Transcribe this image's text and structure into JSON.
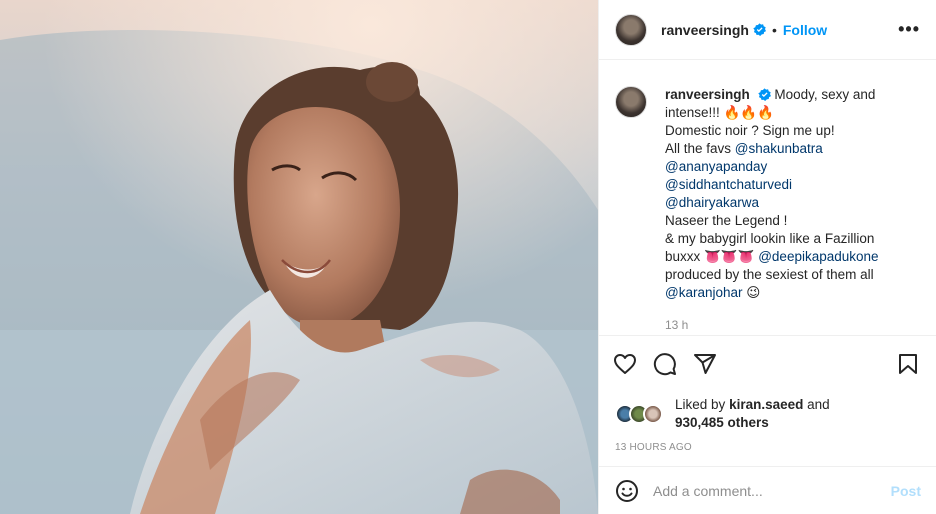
{
  "post": {
    "username": "ranveersingh",
    "follow_label": "Follow",
    "more_label": "•••",
    "separator": "•"
  },
  "caption": {
    "username": "ranveersingh",
    "lines": [
      "Moody, sexy and",
      "intense!!! 🔥🔥🔥",
      "Domestic noir ? Sign me up!",
      "All the favs",
      "@shakunbatra",
      "@ananyapanday",
      "@siddhantchaturvedi",
      "@dhairyakarwa",
      "Naseer the Legend !",
      "& my babygirl lookin like a Fazillion",
      "buxxx 👅👅👅",
      "@deepikapadukone",
      "produced by the sexiest of them all",
      "@karanjohar",
      "😉"
    ],
    "time": "13 h"
  },
  "likes": {
    "prefix": "Liked by",
    "user": "kiran.saeed",
    "and": "and",
    "others": "930,485 others"
  },
  "timestamp": "13 HOURS AGO",
  "comment": {
    "placeholder": "Add a comment...",
    "post_label": "Post"
  },
  "icons": {
    "like": "heart-icon",
    "comment": "comment-icon",
    "share": "paper-plane-icon",
    "save": "bookmark-icon",
    "emoji": "smiley-icon",
    "verified": "verified-badge-icon"
  },
  "colors": {
    "accent": "#0095f6",
    "mention": "#00376b",
    "muted": "#8e8e8e",
    "post_disabled": "#b2dffc"
  }
}
